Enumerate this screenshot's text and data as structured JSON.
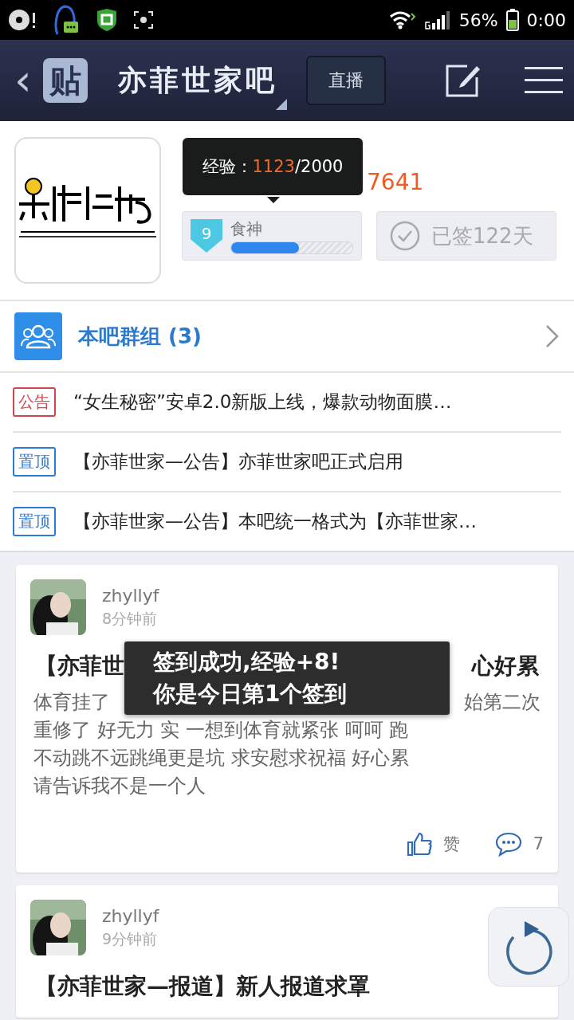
{
  "status_bar": {
    "battery_text": "56%",
    "time": "0:00"
  },
  "nav": {
    "back": "‹",
    "badge": "贴",
    "title": "亦菲世家吧",
    "live_button": "直播"
  },
  "forum": {
    "posts_count": "7641",
    "tooltip": {
      "label": "经验：",
      "current": "1123",
      "total": "/2000"
    },
    "level": {
      "number": "9",
      "title": "食神",
      "level": 0.56
    },
    "sign": {
      "text": "已签122天",
      "signed": true
    }
  },
  "group": {
    "label": "本吧群组",
    "count": "(3)"
  },
  "notices": [
    {
      "tag": "公告",
      "kind": "notice",
      "text": "“女生秘密”安卓2.0新版上线，爆款动物面膜…"
    },
    {
      "tag": "置顶",
      "kind": "pinned",
      "text": "【亦菲世家—公告】亦菲世家吧正式启用"
    },
    {
      "tag": "置顶",
      "kind": "pinned",
      "text": "【亦菲世家—公告】本吧统一格式为【亦菲世家…"
    }
  ],
  "posts": [
    {
      "user": "zhyllyf",
      "time": "8分钟前",
      "title_parts": [
        "【亦菲世",
        "心好累"
      ],
      "body_lines": [
        [
          "体育挂了",
          "始第二次"
        ],
        [
          "重修了 好无力 实 一想到体育就紧张 呵呵 跑"
        ],
        [
          "不动跳不远跳绳更是坑 求安慰求祝福 好心累"
        ],
        [
          "请告诉我不是一个人"
        ]
      ],
      "like": "赞",
      "comments": "7"
    },
    {
      "user": "zhyllyf",
      "time": "9分钟前",
      "title_parts": [
        "【亦菲世家—报道】新人报道求罩"
      ]
    }
  ],
  "toast": [
    "签到成功,经验+8!",
    "你是今日第1个签到"
  ]
}
